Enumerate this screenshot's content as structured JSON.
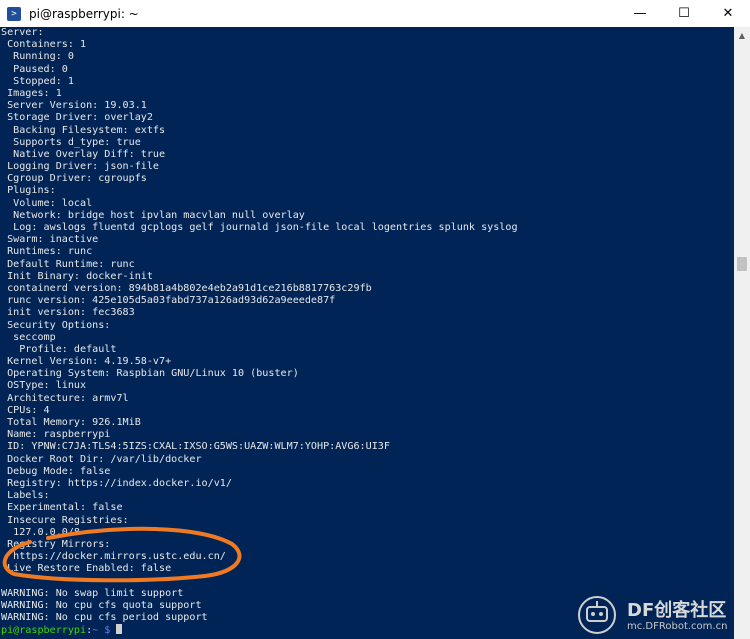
{
  "window": {
    "title": "pi@raspberrypi: ~",
    "icon": "terminal-icon",
    "controls": {
      "minimize": "—",
      "maximize": "☐",
      "close": "✕"
    }
  },
  "terminal": {
    "lines": [
      "Server:",
      " Containers: 1",
      "  Running: 0",
      "  Paused: 0",
      "  Stopped: 1",
      " Images: 1",
      " Server Version: 19.03.1",
      " Storage Driver: overlay2",
      "  Backing Filesystem: extfs",
      "  Supports d_type: true",
      "  Native Overlay Diff: true",
      " Logging Driver: json-file",
      " Cgroup Driver: cgroupfs",
      " Plugins:",
      "  Volume: local",
      "  Network: bridge host ipvlan macvlan null overlay",
      "  Log: awslogs fluentd gcplogs gelf journald json-file local logentries splunk syslog",
      " Swarm: inactive",
      " Runtimes: runc",
      " Default Runtime: runc",
      " Init Binary: docker-init",
      " containerd version: 894b81a4b802e4eb2a91d1ce216b8817763c29fb",
      " runc version: 425e105d5a03fabd737a126ad93d62a9eeede87f",
      " init version: fec3683",
      " Security Options:",
      "  seccomp",
      "   Profile: default",
      " Kernel Version: 4.19.58-v7+",
      " Operating System: Raspbian GNU/Linux 10 (buster)",
      " OSType: linux",
      " Architecture: armv7l",
      " CPUs: 4",
      " Total Memory: 926.1MiB",
      " Name: raspberrypi",
      " ID: YPNW:C7JA:TLS4:5IZS:CXAL:IXSO:G5WS:UAZW:WLM7:YOHP:AVG6:UI3F",
      " Docker Root Dir: /var/lib/docker",
      " Debug Mode: false",
      " Registry: https://index.docker.io/v1/",
      " Labels:",
      " Experimental: false",
      " Insecure Registries:",
      "  127.0.0.0/8",
      " Registry Mirrors:",
      "  https://docker.mirrors.ustc.edu.cn/",
      " Live Restore Enabled: false",
      "",
      "WARNING: No swap limit support",
      "WARNING: No cpu cfs quota support",
      "WARNING: No cpu cfs period support"
    ],
    "prompt": {
      "user_host": "pi@raspberrypi",
      "separator": ":",
      "path": "~ $"
    }
  },
  "annotation": {
    "color": "#f07a22",
    "shape": "ellipse"
  },
  "watermark": {
    "brand": "DF创客社区",
    "url": "mc.DFRobot.com.cn"
  },
  "colors": {
    "terminal_bg": "#012456",
    "text": "#e8e8e8",
    "prompt_user": "#3ad900",
    "prompt_path": "#5b7fff"
  }
}
